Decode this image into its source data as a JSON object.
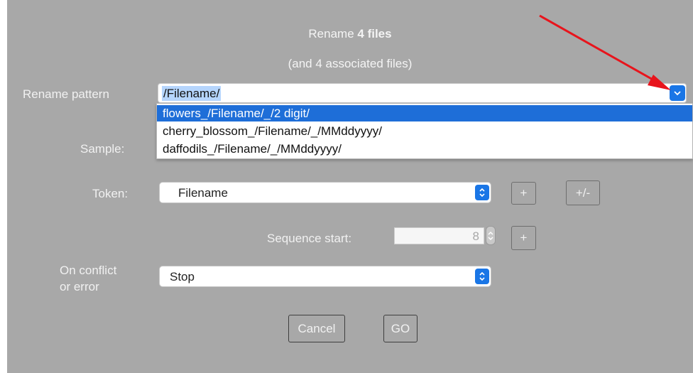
{
  "dialog": {
    "title_prefix": "Rename",
    "title_count": "4 files",
    "subtitle": "(and 4 associated files)"
  },
  "pattern": {
    "label": "Rename pattern",
    "value": "/Filename/",
    "options": [
      "flowers_/Filename/_/2 digit/",
      "cherry_blossom_/Filename/_/MMddyyyy/",
      "daffodils_/Filename/_/MMddyyyy/"
    ],
    "selected_index": 0
  },
  "sample": {
    "label": "Sample:"
  },
  "token": {
    "label": "Token:",
    "value": "Filename",
    "add_label": "+",
    "add_remove_label": "+/-"
  },
  "sequence": {
    "label": "Sequence start:",
    "value": "8",
    "add_label": "+"
  },
  "conflict": {
    "label_line1": "On conflict",
    "label_line2": "or error",
    "value": "Stop"
  },
  "actions": {
    "cancel_label": "Cancel",
    "go_label": "GO"
  },
  "colors": {
    "dialog_bg": "#a8a8a8",
    "accent": "#1a76e6",
    "selection": "#1e6ed8",
    "annotation": "#e8141c"
  }
}
